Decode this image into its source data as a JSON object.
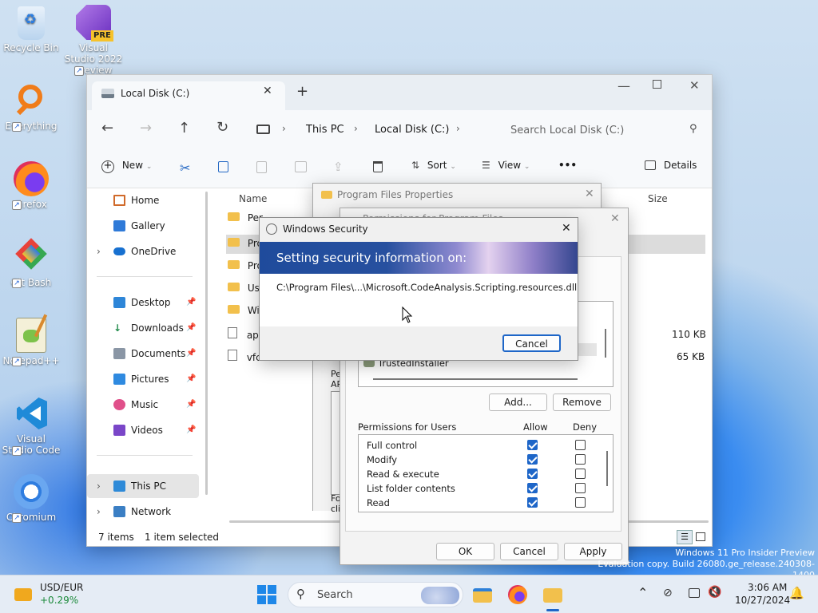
{
  "desktop": {
    "icons": [
      {
        "label": "Recycle Bin",
        "icon": "recycle-bin-icon"
      },
      {
        "label": "Visual Studio 2022 Preview",
        "icon": "visual-studio-preview-icon",
        "badge": "PRE"
      },
      {
        "label": "Everything",
        "icon": "everything-search-icon"
      },
      {
        "label": "Firefox",
        "icon": "firefox-icon"
      },
      {
        "label": "Git Bash",
        "icon": "git-bash-icon"
      },
      {
        "label": "Notepad++",
        "icon": "notepadplusplus-icon"
      },
      {
        "label": "Visual Studio Code",
        "icon": "vscode-icon"
      },
      {
        "label": "Chromium",
        "icon": "chromium-icon"
      }
    ],
    "watermark": {
      "line1": "Windows 11 Pro Insider Preview",
      "line2": "Evaluation copy. Build 26080.ge_release.240308-1400"
    }
  },
  "explorer": {
    "tab_title": "Local Disk (C:)",
    "new_tab": "+",
    "address": {
      "crumb1": "This PC",
      "crumb2": "Local Disk (C:)"
    },
    "search": {
      "placeholder": "Search Local Disk (C:)"
    },
    "commands": {
      "new": "New",
      "sort": "Sort",
      "view": "View",
      "more": "•••",
      "details": "Details"
    },
    "nav": {
      "home": "Home",
      "gallery": "Gallery",
      "onedrive": "OneDrive",
      "desktop": "Desktop",
      "downloads": "Downloads",
      "documents": "Documents",
      "pictures": "Pictures",
      "music": "Music",
      "videos": "Videos",
      "this_pc": "This PC",
      "network": "Network"
    },
    "columns": {
      "name": "Name",
      "size": "Size"
    },
    "files": [
      {
        "name": "Per",
        "size": ""
      },
      {
        "name": "Pro",
        "size": ""
      },
      {
        "name": "Pro",
        "size": ""
      },
      {
        "name": "Use",
        "size": ""
      },
      {
        "name": "Win",
        "size": ""
      },
      {
        "name": "app",
        "size": "110 KB"
      },
      {
        "name": "vfc",
        "size": "65 KB"
      }
    ],
    "status": {
      "items": "7 items",
      "selected": "1 item selected"
    }
  },
  "properties": {
    "title": "Program Files Properties",
    "tab_text_1": "Pe",
    "tab_text_2": "AP",
    "tab_text_3": "Fo",
    "tab_text_4": "clic"
  },
  "permissions": {
    "title": "Permissions for Program Files",
    "group_item": "TrustedInstaller",
    "add": "Add...",
    "remove": "Remove",
    "perm_header": "Permissions for Users",
    "allow": "Allow",
    "deny": "Deny",
    "rows": [
      {
        "label": "Full control",
        "allow": true,
        "deny": false
      },
      {
        "label": "Modify",
        "allow": true,
        "deny": false
      },
      {
        "label": "Read & execute",
        "allow": true,
        "deny": false
      },
      {
        "label": "List folder contents",
        "allow": true,
        "deny": false
      },
      {
        "label": "Read",
        "allow": true,
        "deny": false
      }
    ],
    "ok": "OK",
    "cancel": "Cancel",
    "apply": "Apply"
  },
  "security": {
    "title": "Windows Security",
    "heading": "Setting security information on:",
    "path": "C:\\Program Files\\...\\Microsoft.CodeAnalysis.Scripting.resources.dll",
    "cancel": "Cancel"
  },
  "taskbar": {
    "widget": {
      "title": "USD/EUR",
      "change": "+0.29%"
    },
    "search": "Search",
    "time": "3:06 AM",
    "date": "10/27/2024"
  },
  "colors": {
    "accent": "#1e66c8",
    "change_positive": "#1b8a3a"
  }
}
